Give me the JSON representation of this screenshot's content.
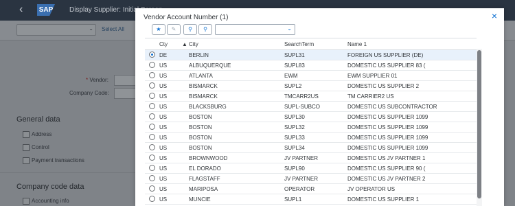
{
  "shell": {
    "back_icon": "back-arrow-icon",
    "logo_text": "SAP",
    "app_title": "Display Supplier: Initial Screen"
  },
  "background": {
    "select_all": "Select All",
    "vendor_label": "Vendor:",
    "required_mark": "*",
    "company_code_label": "Company Code:",
    "general_data": "General data",
    "general_items": [
      "Address",
      "Control",
      "Payment transactions"
    ],
    "company_code_data": "Company code data",
    "company_items": [
      "Accounting info"
    ]
  },
  "dialog": {
    "title": "Vendor Account Number (1)",
    "close_icon": "close-icon",
    "toolbar_icons": [
      "filter-icon",
      "settings-icon",
      "search-icon",
      "find-icon"
    ],
    "search_value": "",
    "columns": {
      "cty": "Cty",
      "city": "City",
      "term": "SearchTerm",
      "name": "Name 1"
    },
    "rows": [
      {
        "cty": "DE",
        "city": "BERLIN",
        "term": "SUPL31",
        "name": "FOREIGN US SUPPLIER (DE)",
        "selected": true
      },
      {
        "cty": "US",
        "city": "ALBUQUERQUE",
        "term": "SUPL83",
        "name": "DOMESTIC US SUPPLIER 83 (",
        "selected": false
      },
      {
        "cty": "US",
        "city": "ATLANTA",
        "term": "EWM",
        "name": "EWM SUPPLIER 01",
        "selected": false
      },
      {
        "cty": "US",
        "city": "BISMARCK",
        "term": "SUPL2",
        "name": "DOMESTIC US SUPPLIER 2",
        "selected": false
      },
      {
        "cty": "US",
        "city": "BISMARCK",
        "term": "TMCARR2US",
        "name": "TM CARRIER2 US",
        "selected": false
      },
      {
        "cty": "US",
        "city": "BLACKSBURG",
        "term": "SUPL-SUBCO",
        "name": "DOMESTIC US SUBCONTRACTOR",
        "selected": false
      },
      {
        "cty": "US",
        "city": "BOSTON",
        "term": "SUPL30",
        "name": "DOMESTIC US SUPPLIER 1099",
        "selected": false
      },
      {
        "cty": "US",
        "city": "BOSTON",
        "term": "SUPL32",
        "name": "DOMESTIC US SUPPLIER 1099",
        "selected": false
      },
      {
        "cty": "US",
        "city": "BOSTON",
        "term": "SUPL33",
        "name": "DOMESTIC US SUPPLIER 1099",
        "selected": false
      },
      {
        "cty": "US",
        "city": "BOSTON",
        "term": "SUPL34",
        "name": "DOMESTIC US SUPPLIER 1099",
        "selected": false
      },
      {
        "cty": "US",
        "city": "BROWNWOOD",
        "term": "JV PARTNER",
        "name": "DOMESTIC US JV PARTNER 1",
        "selected": false
      },
      {
        "cty": "US",
        "city": "EL DORADO",
        "term": "SUPL90",
        "name": "DOMESTIC US SUPPLIER 90 (",
        "selected": false
      },
      {
        "cty": "US",
        "city": "FLAGSTAFF",
        "term": "JV PARTNER",
        "name": "DOMESTIC US JV PARTNER 2",
        "selected": false
      },
      {
        "cty": "US",
        "city": "MARIPOSA",
        "term": "OPERATOR",
        "name": "JV OPERATOR US",
        "selected": false
      },
      {
        "cty": "US",
        "city": "MUNCIE",
        "term": "SUPL1",
        "name": "DOMESTIC US SUPPLIER 1",
        "selected": false
      }
    ]
  }
}
